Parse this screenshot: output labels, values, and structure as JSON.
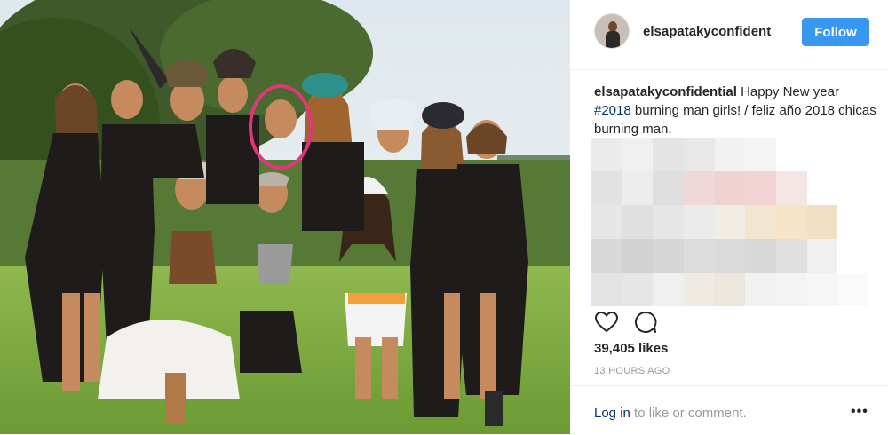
{
  "post": {
    "username": "elsapatakyconfident",
    "follow_label": "Follow",
    "caption": {
      "username": "elsapatakyconfidential",
      "text_before": " Happy New year ",
      "hashtag": "#2018",
      "text_after": " burning man girls! / feliz año 2018 chicas burning man."
    },
    "likes": "39,405 likes",
    "time": "13 HOURS AGO",
    "login_link": "Log in",
    "login_rest": " to like or comment.",
    "more_label": "•••"
  },
  "icons": {
    "like": "heart-icon",
    "comment": "comment-bubble-icon",
    "more": "more-options-icon"
  },
  "colors": {
    "follow_button": "#3897f0",
    "link": "#003569",
    "highlight_circle": "#e0367a"
  },
  "mosaic_colors": [
    "#ebebeb",
    "#f0f0f0",
    "#e4e4e4",
    "#e8e8e8",
    "#f2f2f2",
    "#f5f5f5",
    "#ffffff",
    "#ffffff",
    "#ffffff",
    "#e2e2e2",
    "#ececec",
    "#dedede",
    "#f0d8d8",
    "#f0d2d2",
    "#f2d4d4",
    "#f5e6e6",
    "#ffffff",
    "#ffffff",
    "#e6e6e6",
    "#e0e0e0",
    "#e6e6e6",
    "#ebebeb",
    "#f1ece4",
    "#f3e6d0",
    "#f5e4c8",
    "#f1e0c4",
    "#ffffff",
    "#d8d8d8",
    "#d2d2d2",
    "#d6d6d6",
    "#dcdcdc",
    "#dadada",
    "#d8d8d8",
    "#e0e0e0",
    "#f0f0f0",
    "#ffffff",
    "#e3e3e3",
    "#e6e6e6",
    "#efefef",
    "#f0ebe2",
    "#ece6dc",
    "#f2f2f2",
    "#f4f4f4",
    "#f6f6f6",
    "#fafafa"
  ]
}
